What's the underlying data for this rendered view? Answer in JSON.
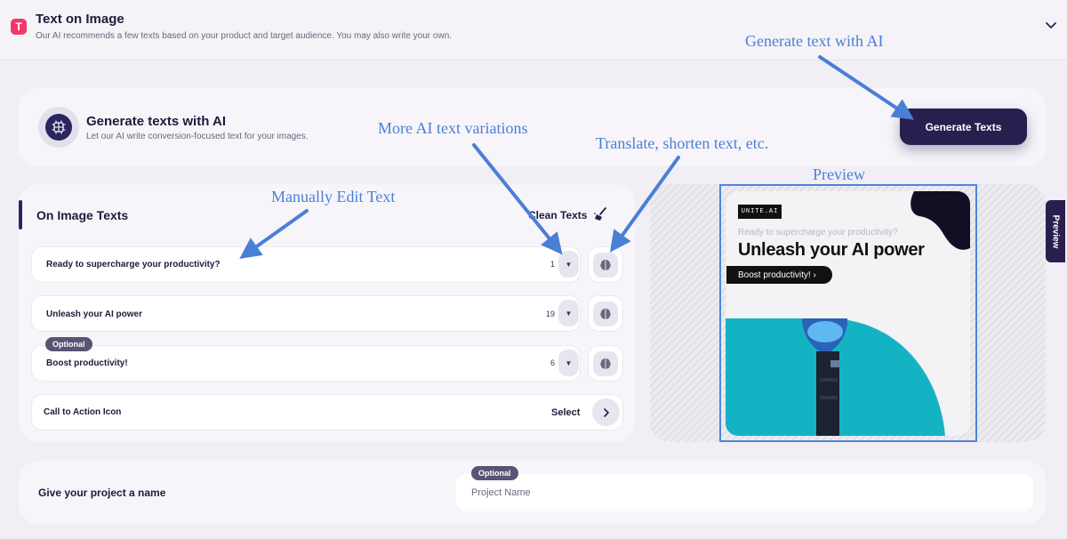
{
  "header": {
    "icon_letter": "T",
    "title": "Text on Image",
    "subtitle": "Our AI recommends a few texts based on your product and target audience. You may also write your own."
  },
  "generate": {
    "title": "Generate texts with AI",
    "subtitle": "Let our AI write conversion-focused text for your images.",
    "button_label": "Generate Texts"
  },
  "texts_panel": {
    "title": "On Image Texts",
    "clean_label": "Clean Texts",
    "rows": [
      {
        "text": "Ready to supercharge your productivity?",
        "count": "1",
        "optional": false
      },
      {
        "text": "Unleash your AI power",
        "count": "19",
        "optional": false
      },
      {
        "text": "Boost productivity!",
        "count": "6",
        "optional": true,
        "optional_label": "Optional"
      }
    ],
    "cta": {
      "label": "Call to Action Icon",
      "select_label": "Select"
    }
  },
  "preview": {
    "tab_label": "Preview",
    "ad": {
      "logo": "UNITE.AI",
      "small_text": "Ready to supercharge your productivity?",
      "headline": "Unleash your AI power",
      "cta": "Boost productivity! ›"
    }
  },
  "project": {
    "label": "Give your project a name",
    "optional_label": "Optional",
    "placeholder": "Project Name"
  },
  "annotations": {
    "generate_ai": "Generate text with AI",
    "more_variations": "More AI text variations",
    "translate": "Translate, shorten text, etc.",
    "manual_edit": "Manually Edit Text",
    "preview": "Preview"
  },
  "colors": {
    "primary_dark": "#27204f",
    "accent_pink": "#f2386b",
    "annotation_blue": "#4a7fd6",
    "ad_teal": "#14b3c4"
  }
}
